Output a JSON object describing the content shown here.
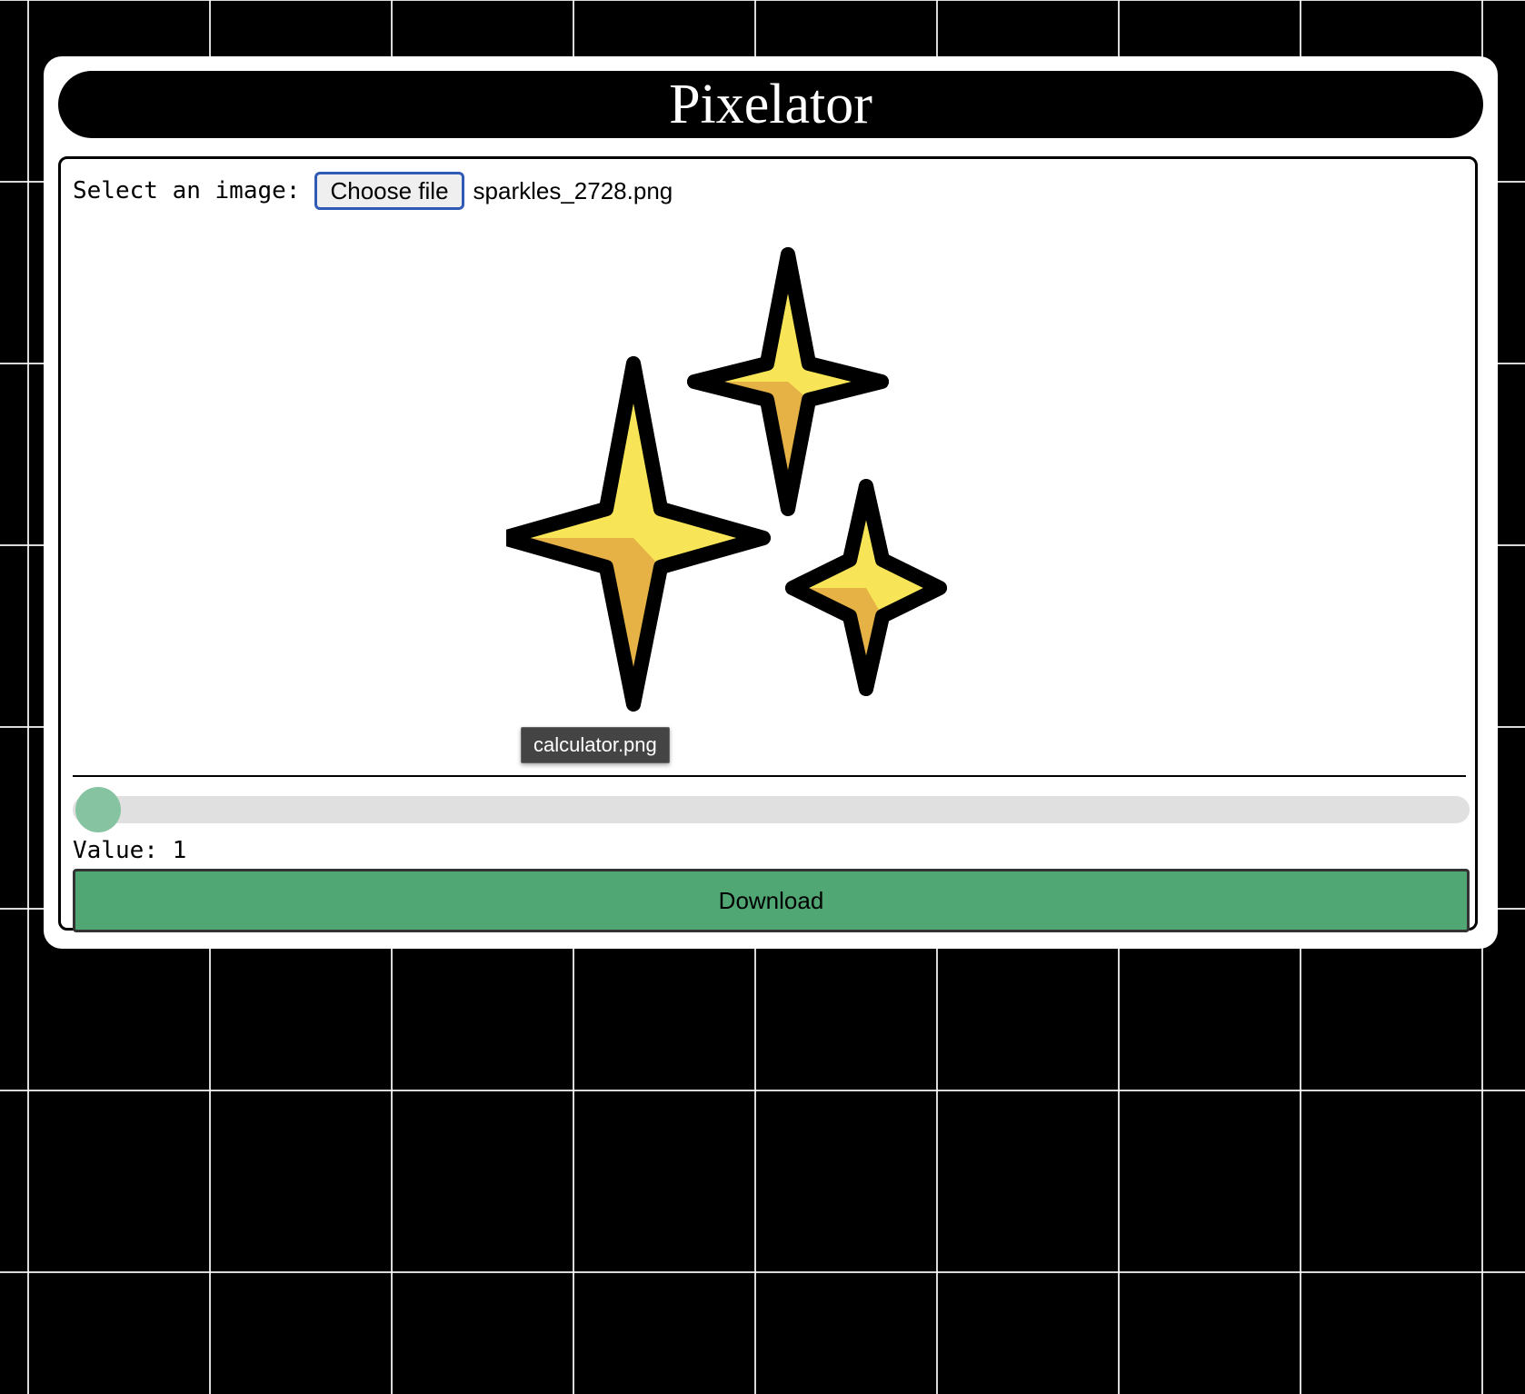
{
  "app": {
    "title": "Pixelator"
  },
  "file_select": {
    "label": "Select an image:",
    "button_label": "Choose file",
    "file_name": "sparkles_2728.png"
  },
  "preview": {
    "icon": "sparkles-icon",
    "colors": {
      "outline": "#000000",
      "highlight": "#f8e557",
      "shade": "#e6b245"
    }
  },
  "tooltip": {
    "text": "calculator.png"
  },
  "slider": {
    "value": 1,
    "min": 1,
    "max": 100,
    "thumb_color": "#86c3a0",
    "track_color": "#e0e0e0"
  },
  "value_display": {
    "label": "Value:",
    "value": "1"
  },
  "download": {
    "label": "Download",
    "color": "#50a774"
  }
}
